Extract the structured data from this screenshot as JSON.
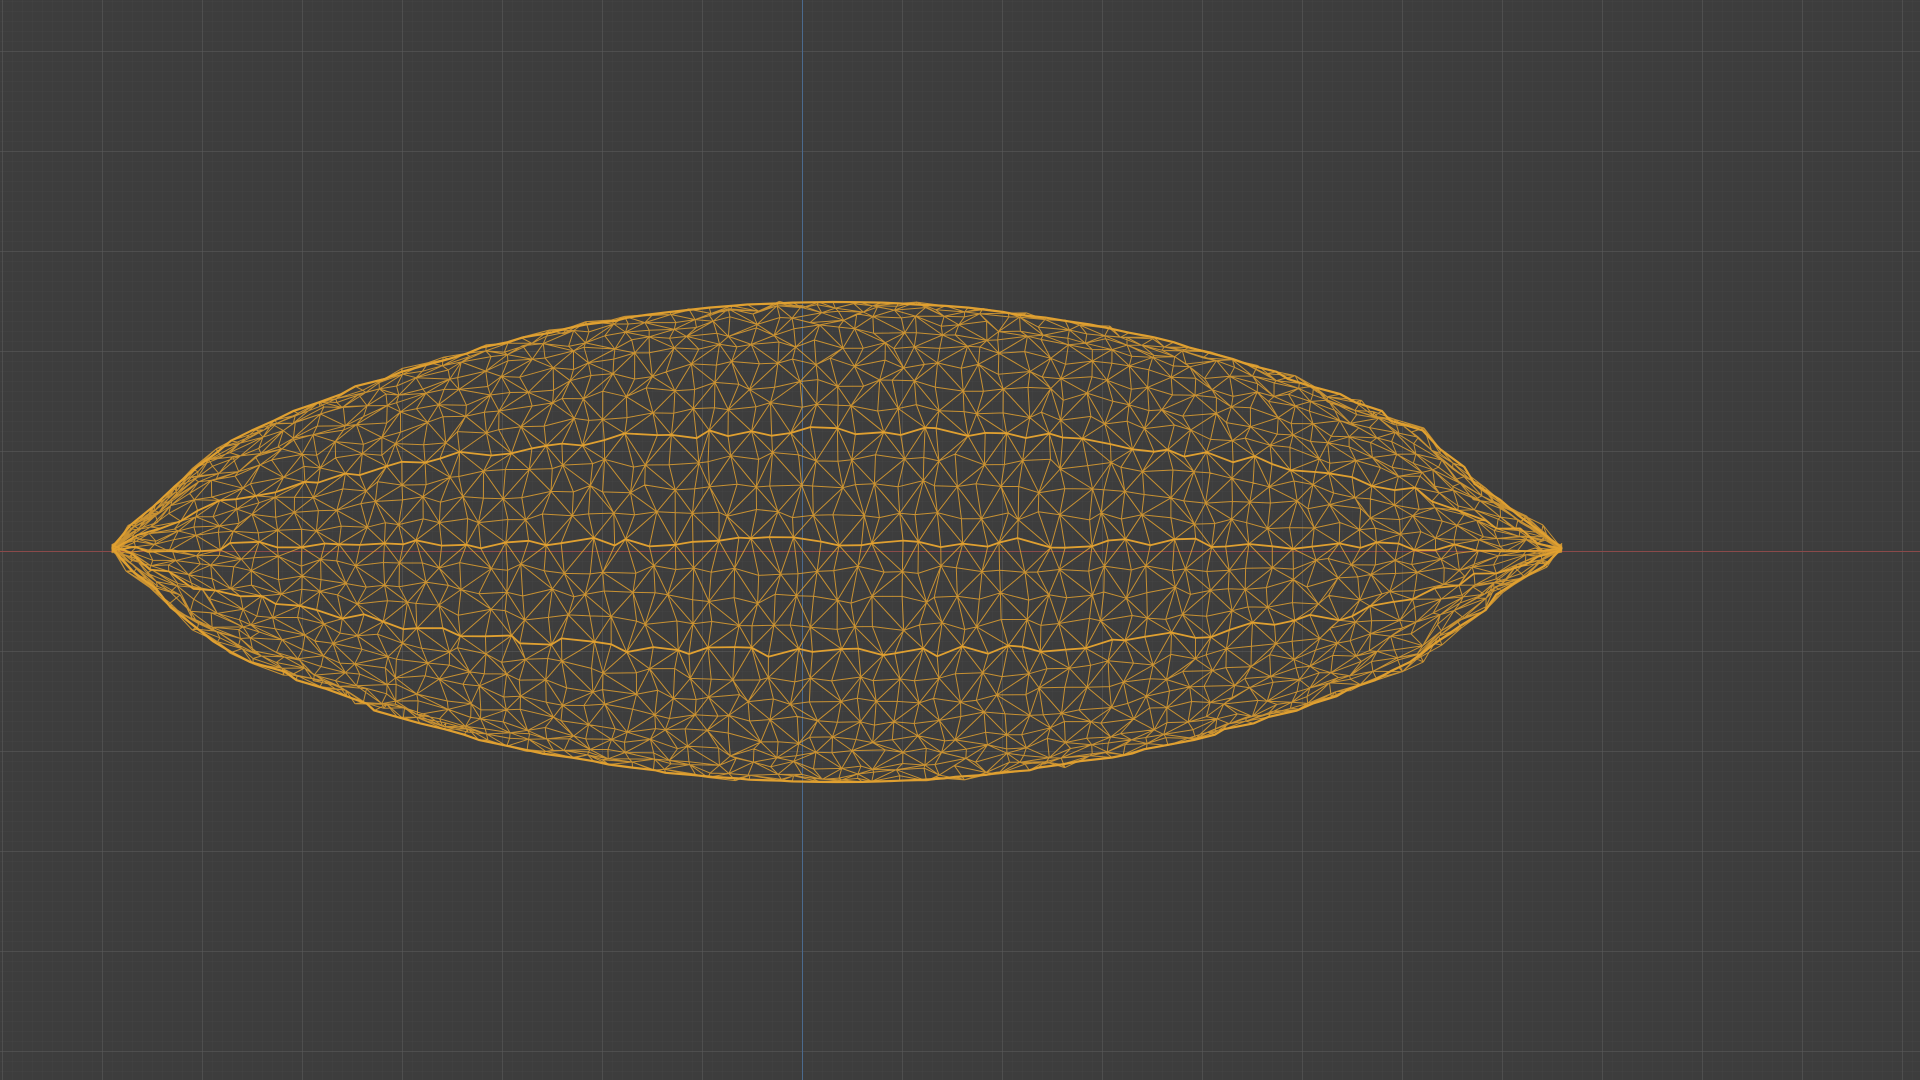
{
  "viewport": {
    "mode": "wireframe",
    "grid": true,
    "colors": {
      "background": "#3d3d3d",
      "grid_major": "#5a5a5a",
      "grid_minor": "#464646",
      "axis_x": "#8a4a4a",
      "axis_y": "#4b6a8e",
      "wireframe": "#e0a030"
    }
  },
  "object": {
    "type": "mesh",
    "display": "wireframe",
    "selected": true
  }
}
